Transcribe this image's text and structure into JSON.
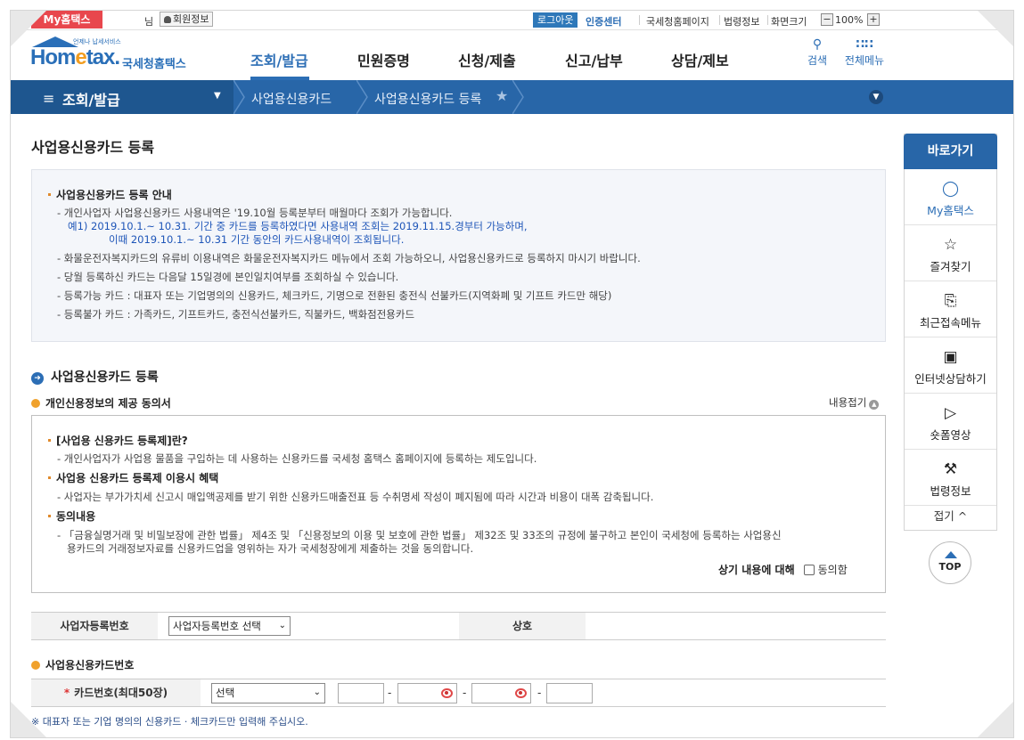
{
  "topbar": {
    "my_hometax": "My홈택스",
    "nim": "님",
    "member_info": "회원정보",
    "logout": "로그아웃",
    "cert_center": "인증센터",
    "links": [
      "국세청홈페이지",
      "법령정보",
      "화면크기"
    ],
    "zoom_minus": "−",
    "zoom_value": "100%",
    "zoom_plus": "+"
  },
  "header": {
    "logo_small": "언제나 납세서비스",
    "logo_main_a": "Hom",
    "logo_main_b": "e",
    "logo_main_c": "tax.",
    "logo_sub": "국세청홈택스",
    "menu": [
      "조회/발급",
      "민원증명",
      "신청/제출",
      "신고/납부",
      "상담/제보"
    ],
    "active_menu": "조회/발급",
    "search_label": "검색",
    "allmenu_label": "전체메뉴"
  },
  "nav": {
    "section": "조회/발급",
    "crumbs": [
      "사업용신용카드",
      "사업용신용카드 등록"
    ]
  },
  "page": {
    "title": "사업용신용카드 등록",
    "guide": {
      "heading": "사업용신용카드 등록 안내",
      "lines": [
        "- 개인사업자 사업용신용카드 사용내역은 '19.10월 등록분부터 매월마다 조회가 가능합니다.",
        "예1) 2019.10.1.~ 10.31. 기간 중 카드를 등록하였다면 사용내역 조회는 2019.11.15.경부터 가능하며,",
        "이때 2019.10.1.~ 10.31 기간 동안의 카드사용내역이 조회됩니다.",
        "- 화물운전자복지카드의 유류비 이용내역은 화물운전자복지카드 메뉴에서 조회 가능하오니, 사업용신용카드로 등록하지 마시기 바랍니다.",
        "- 당월 등록하신 카드는 다음달 15일경에 본인일치여부를 조회하실 수 있습니다.",
        "- 등록가능 카드 : 대표자 또는 기업명의의 신용카드, 체크카드, 기명으로 전환된 충전식 선불카드(지역화폐 및 기프트 카드만 해당)",
        "- 등록불가 카드 : 가족카드, 기프트카드, 충전식선불카드, 직불카드, 백화점전용카드"
      ]
    },
    "section_title": "사업용신용카드 등록",
    "consent_title": "개인신용정보의 제공 동의서",
    "collapse_label": "내용접기",
    "consent": {
      "h1": "[사업용 신용카드 등록제]란?",
      "t1": "- 개인사업자가 사업용 물품을 구입하는 데 사용하는 신용카드를 국세청 홈택스 홈페이지에 등록하는 제도입니다.",
      "h2": "사업용 신용카드 등록제 이용시 혜택",
      "t2": "- 사업자는 부가가치세 신고시 매입액공제를 받기 위한 신용카드매출전표 등 수취명세 작성이 폐지됨에 따라 시간과 비용이 대폭 감축됩니다.",
      "h3": "동의내용",
      "t3a": "- 「금융실명거래 및 비밀보장에 관한 법률」 제4조 및 「신용정보의 이용 및 보호에 관한 법률」 제32조 및 33조의 규정에 불구하고 본인이 국세청에 등록하는 사업용신",
      "t3b": "용카드의    거래정보자료를 신용카드업을 영위하는 자가 국세청장에게 제출하는 것을 동의합니다.",
      "agree_label": "상기 내용에 대해",
      "agree_check": "동의함"
    },
    "biz": {
      "reg_no_label": "사업자등록번호",
      "reg_no_select": "사업자등록번호 선택",
      "name_label": "상호"
    },
    "card_title": "사업용신용카드번호",
    "card": {
      "label": "카드번호(최대50장)",
      "select": "선택"
    },
    "note": "※ 대표자 또는 기업 명의의 신용카드 · 체크카드만 입력해 주십시오."
  },
  "quick_menu": {
    "title": "바로가기",
    "items": [
      {
        "label": "My홈택스",
        "icon": "person-icon"
      },
      {
        "label": "즐겨찾기",
        "icon": "star-icon"
      },
      {
        "label": "최근접속메뉴",
        "icon": "recent-icon"
      },
      {
        "label": "인터넷상담하기",
        "icon": "laptop-icon"
      },
      {
        "label": "숏폼영상",
        "icon": "play-icon"
      },
      {
        "label": "법령정보",
        "icon": "gavel-icon"
      }
    ],
    "fold": "접기 ^",
    "top": "TOP"
  },
  "colors": {
    "brand_blue": "#2866a8",
    "accent_red": "#e8474d",
    "accent_orange": "#f0a12c"
  }
}
